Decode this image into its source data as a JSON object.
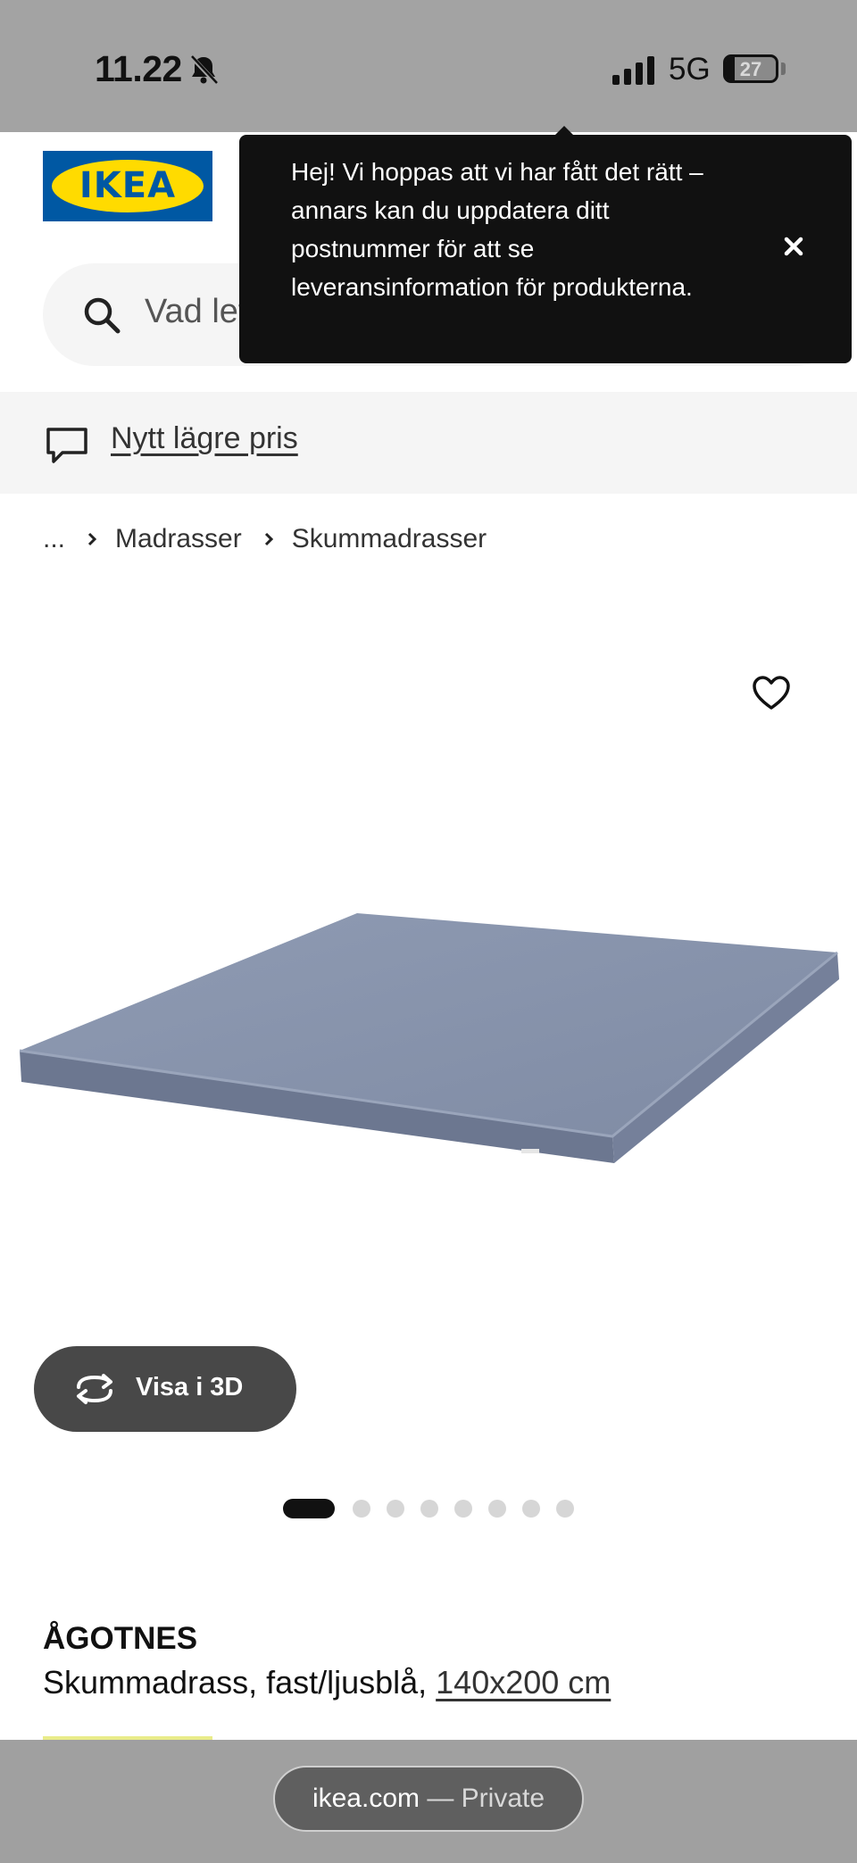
{
  "status_bar": {
    "time": "11.22",
    "network": "5G",
    "battery": "27"
  },
  "header": {
    "logo_text": "IKEA",
    "search_placeholder": "Vad letar du efter?"
  },
  "tooltip": {
    "message": "Hej! Vi hoppas att vi har fått det rätt – annars kan du uppdatera ditt postnummer för att se leveransinformation för produkterna."
  },
  "promo": {
    "label": "Nytt lägre pris"
  },
  "breadcrumb": {
    "items": [
      "...",
      "Madrasser",
      "Skummadrasser"
    ]
  },
  "gallery": {
    "view_3d_label": "Visa i 3D",
    "image_count": 8,
    "active_index": 0
  },
  "product": {
    "name": "ÅGOTNES",
    "description": "Skummadrass, fast/ljusblå, ",
    "size": "140x200 cm"
  },
  "browser": {
    "domain": "ikea.com",
    "mode": " — Private"
  },
  "colors": {
    "ikea_blue": "#0058a3",
    "ikea_yellow": "#ffdb00",
    "mattress_blue": "#8a96ad"
  }
}
